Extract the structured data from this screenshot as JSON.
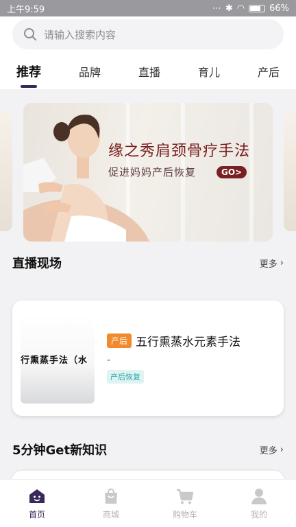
{
  "status_bar": {
    "time": "上午9:59",
    "battery": "66%",
    "battery_level": 0.66
  },
  "search": {
    "placeholder": "请输入搜索内容"
  },
  "tabs": [
    {
      "label": "推荐",
      "active": true
    },
    {
      "label": "品牌"
    },
    {
      "label": "直播"
    },
    {
      "label": "育儿"
    },
    {
      "label": "产后"
    }
  ],
  "banner": {
    "headline": "缘之秀肩颈骨疗手法",
    "subline": "促进妈妈产后恢复",
    "cta": "GO>"
  },
  "live_section": {
    "title": "直播现场",
    "more": "更多"
  },
  "live_card": {
    "thumbnail_text": "行熏蒸手法（水",
    "tag": "产后",
    "title": "五行熏蒸水元素手法",
    "subtitle": "-",
    "category": "产后恢复"
  },
  "knowledge_section": {
    "title": "5分钟Get新知识",
    "more": "更多"
  },
  "bottom_nav": [
    {
      "label": "首页",
      "icon": "home-icon",
      "active": true
    },
    {
      "label": "商城",
      "icon": "shopping-bag-icon"
    },
    {
      "label": "购物车",
      "icon": "cart-icon"
    },
    {
      "label": "我的",
      "icon": "user-icon"
    }
  ],
  "colors": {
    "accent": "#3a2859",
    "tag_orange": "#f08a2a",
    "tag_teal": "#2aa6a6",
    "banner_text": "#7a2020"
  }
}
